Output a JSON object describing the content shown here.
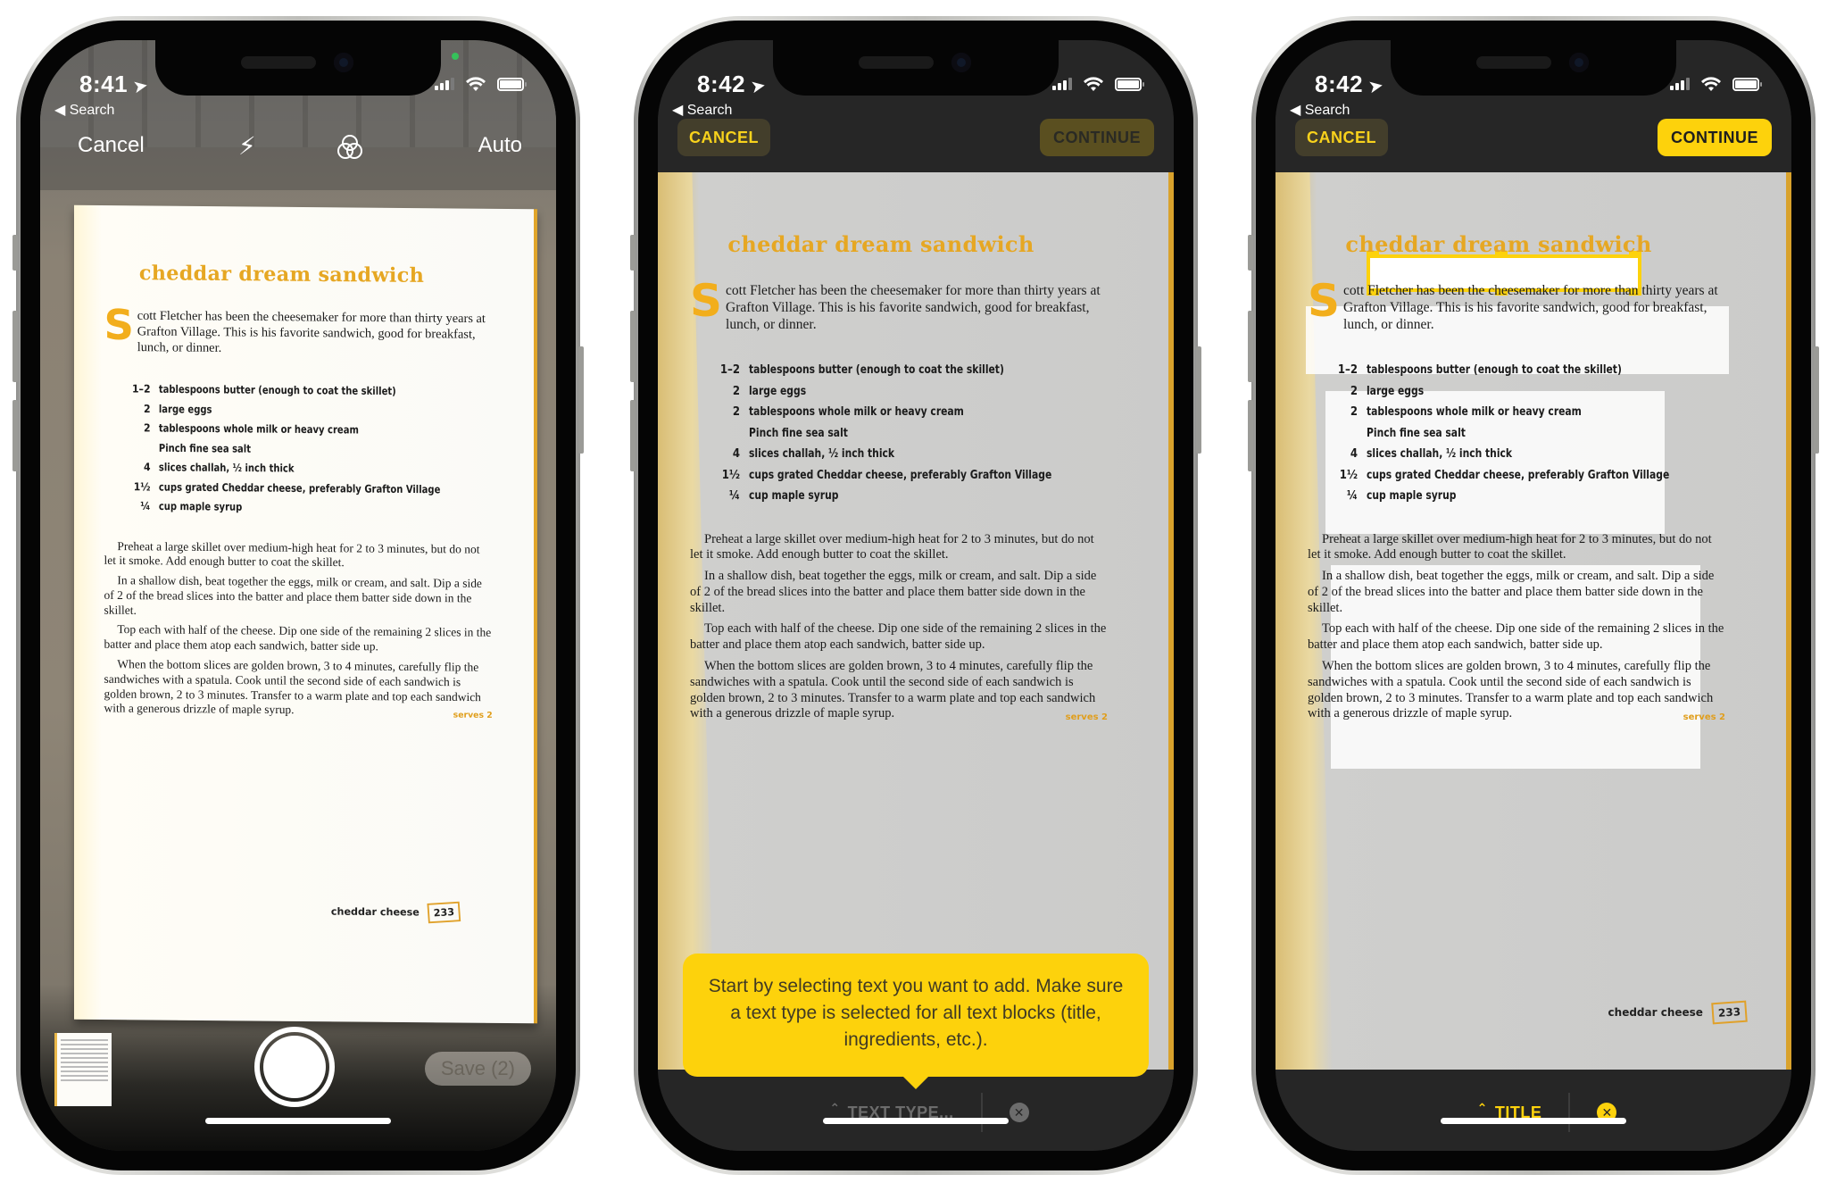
{
  "colors": {
    "accent_yellow": "#fdd20c",
    "recipe_orange": "#e6a723",
    "toolbar_dark": "#262626"
  },
  "recipe": {
    "title": "cheddar dream sandwich",
    "drop_cap": "S",
    "intro": "cott Fletcher has been the cheesemaker for more than thirty years at Grafton Village. This is his favorite sandwich, good for breakfast, lunch, or dinner.",
    "ingredients": [
      {
        "qty": "1–2",
        "text": "tablespoons butter (enough to coat the skillet)"
      },
      {
        "qty": "2",
        "text": "large eggs"
      },
      {
        "qty": "2",
        "text": "tablespoons whole milk or heavy cream"
      },
      {
        "qty": "",
        "text": "Pinch fine sea salt"
      },
      {
        "qty": "4",
        "text": "slices challah, ½ inch thick"
      },
      {
        "qty": "1½",
        "text": "cups grated Cheddar cheese, preferably Grafton Village"
      },
      {
        "qty": "¼",
        "text": "cup maple syrup"
      }
    ],
    "steps": [
      "Preheat a large skillet over medium-high heat for 2 to 3 minutes, but do not let it smoke. Add enough butter to coat the skillet.",
      "In a shallow dish, beat together the eggs, milk or cream, and salt. Dip a side of 2 of the bread slices into the batter and place them batter side down in the skillet.",
      "Top each with half of the cheese. Dip one side of the remaining 2 slices in the batter and place them atop each sandwich, batter side up.",
      "When the bottom slices are golden brown, 3 to 4 minutes, carefully flip the sandwiches with a spatula. Cook until the second side of each sandwich is golden brown, 2 to 3 minutes. Transfer to a warm plate and top each sandwich with a generous drizzle of maple syrup."
    ],
    "serves": "serves 2",
    "footer_label": "cheddar cheese",
    "page_number": "233"
  },
  "phones": [
    {
      "status": {
        "time": "8:41",
        "back_label": "Search"
      },
      "camera": {
        "cancel_label": "Cancel",
        "flash_icon": "flash-icon",
        "filter_icon": "filters-icon",
        "mode_label": "Auto",
        "save_label": "Save (2)"
      }
    },
    {
      "status": {
        "time": "8:42",
        "back_label": "Search"
      },
      "toolbar": {
        "cancel_label": "CANCEL",
        "continue_label": "CONTINUE",
        "continue_enabled": false
      },
      "tip": "Start by selecting text you want to add. Make sure a text type is selected for all text blocks (title, ingredients, etc.).",
      "text_type": {
        "label": "TEXT TYPE...",
        "clear_icon": "clear-icon"
      }
    },
    {
      "status": {
        "time": "8:42",
        "back_label": "Search"
      },
      "toolbar": {
        "cancel_label": "CANCEL",
        "continue_label": "CONTINUE",
        "continue_enabled": true
      },
      "text_type": {
        "label": "TITLE",
        "clear_icon": "clear-icon"
      }
    }
  ]
}
